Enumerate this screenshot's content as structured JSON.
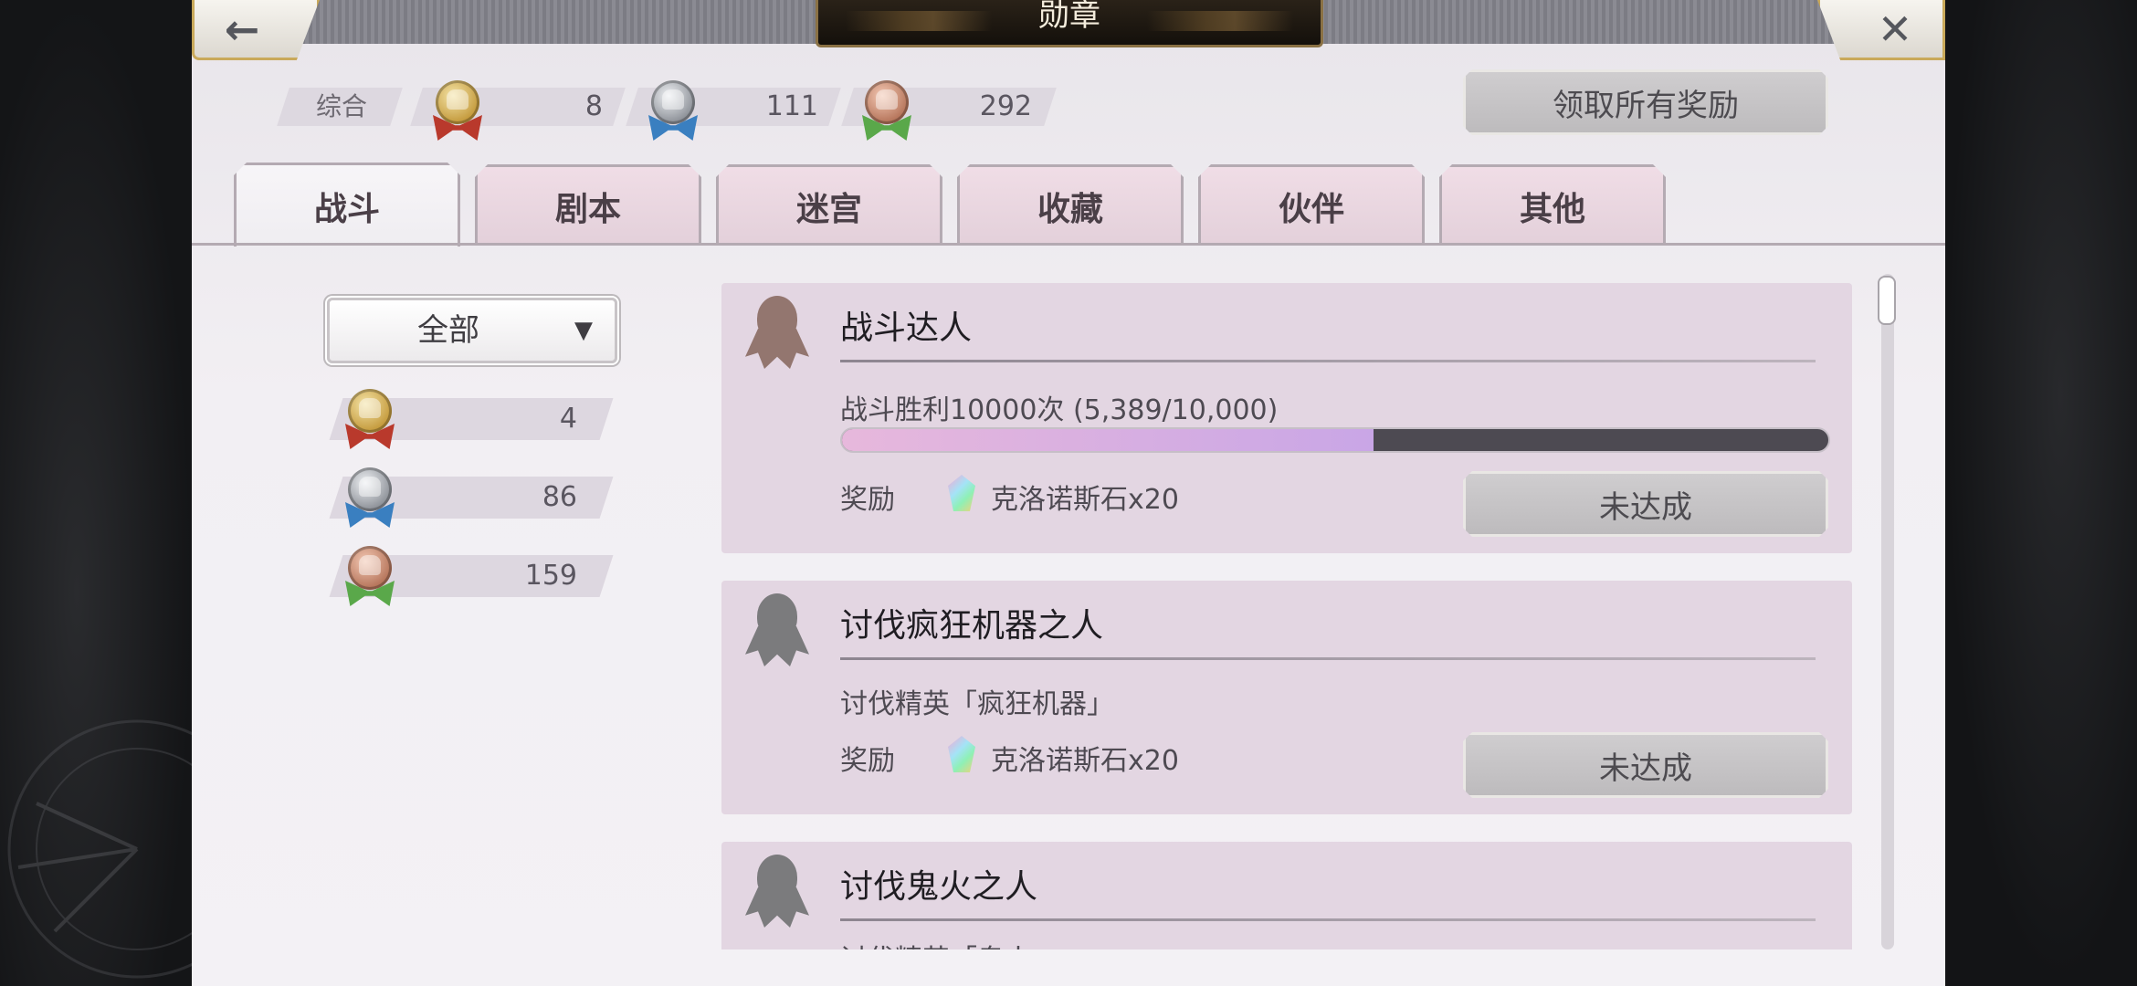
{
  "header": {
    "title": "勋章",
    "back_icon": "←",
    "close_icon": "✕"
  },
  "totals": {
    "label": "综合",
    "gold": "8",
    "silver": "111",
    "bronze": "292"
  },
  "claim_all_label": "领取所有奖励",
  "tabs": [
    {
      "label": "战斗",
      "active": true
    },
    {
      "label": "剧本"
    },
    {
      "label": "迷宫"
    },
    {
      "label": "收藏"
    },
    {
      "label": "伙伴"
    },
    {
      "label": "其他"
    }
  ],
  "filter": {
    "selected": "全部",
    "arrow": "▼"
  },
  "side_counts": {
    "gold": "4",
    "silver": "86",
    "bronze": "159"
  },
  "achievements": [
    {
      "title": "战斗达人",
      "description": "战斗胜利10000次 (5,389/10,000)",
      "progress": 0.5389,
      "reward_label": "奖励",
      "reward": "克洛诺斯石x20",
      "status": "未达成"
    },
    {
      "title": "讨伐疯狂机器之人",
      "description": "讨伐精英「疯狂机器」",
      "reward_label": "奖励",
      "reward": "克洛诺斯石x20",
      "status": "未达成"
    },
    {
      "title": "讨伐鬼火之人",
      "description": "讨伐精英「鬼火」"
    }
  ],
  "colors": {
    "panel": "#f2eff3",
    "card": "#e3d6e2",
    "progress_fill": "#d9b0e2",
    "progress_track": "#4d4a52",
    "gold_ribbon": "#b9392c",
    "silver_ribbon": "#3a7fc0",
    "bronze_ribbon": "#5aa84a"
  }
}
